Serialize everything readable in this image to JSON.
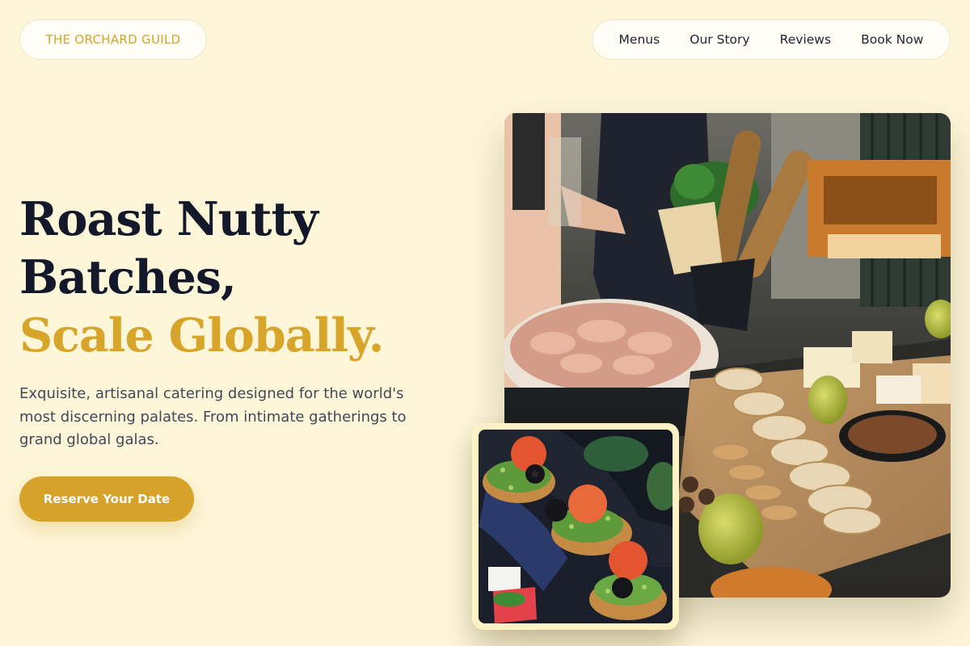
{
  "brand": {
    "name": "THE ORCHARD GUILD"
  },
  "nav": {
    "items": [
      "Menus",
      "Our Story",
      "Reviews",
      "Book Now"
    ]
  },
  "hero": {
    "headline_line1": "Roast Nutty",
    "headline_line2": "Batches,",
    "headline_accent": "Scale Globally.",
    "subtext": "Exquisite, artisanal catering designed for the world's most discerning palates. From intimate gatherings to grand global galas.",
    "cta_label": "Reserve Your Date"
  },
  "colors": {
    "background": "#fef6d8",
    "accent": "#d6a52a",
    "heading": "#13182a",
    "body_text": "#434858"
  }
}
